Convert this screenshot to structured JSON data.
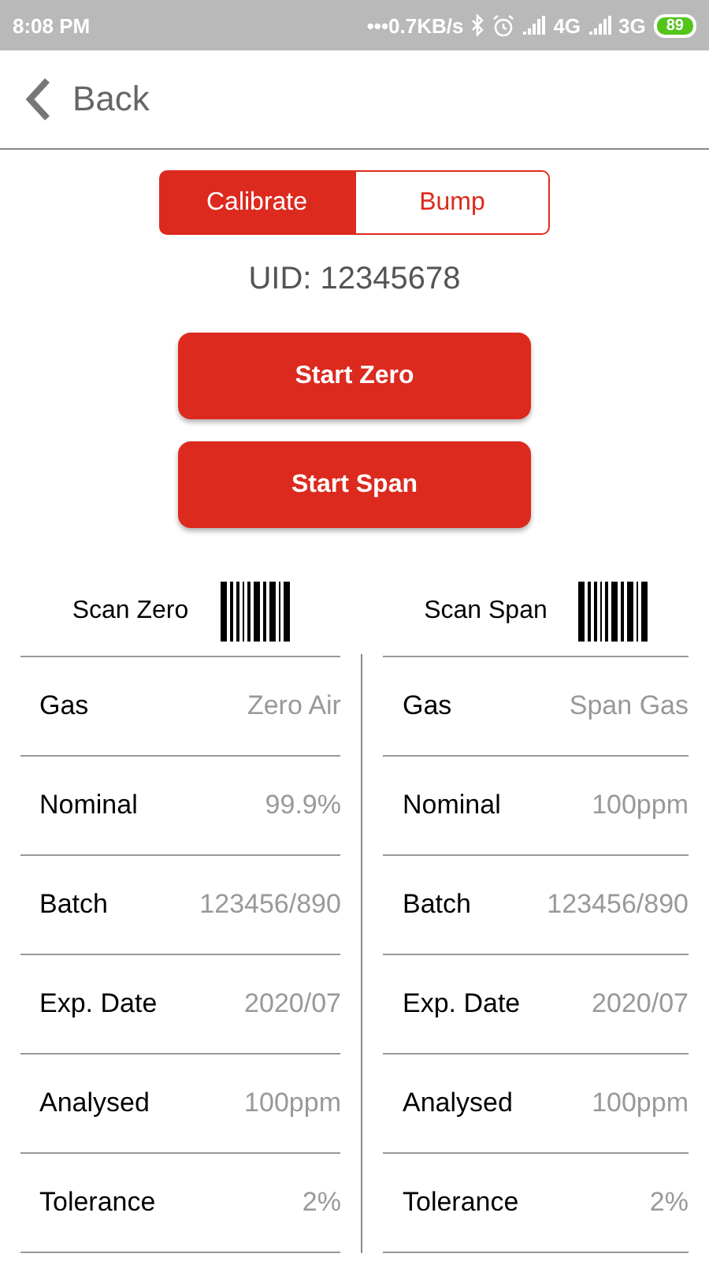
{
  "status_bar": {
    "time": "8:08 PM",
    "speed": "•••0.7KB/s",
    "network_1": "4G",
    "network_2": "3G",
    "battery": "89"
  },
  "header": {
    "back": "Back"
  },
  "tabs": [
    {
      "label": "Calibrate",
      "selected": true
    },
    {
      "label": "Bump",
      "selected": false
    }
  ],
  "uid": "UID: 12345678",
  "buttons": [
    "Start Zero",
    "Start Span"
  ],
  "panels": [
    {
      "scan": "Scan Zero",
      "rows": [
        {
          "label": "Gas",
          "value": "Zero Air"
        },
        {
          "label": "Nominal",
          "value": "99.9%"
        },
        {
          "label": "Batch",
          "value": "123456/890"
        },
        {
          "label": "Exp. Date",
          "value": "2020/07"
        },
        {
          "label": "Analysed",
          "value": "100ppm"
        },
        {
          "label": "Tolerance",
          "value": "2%"
        }
      ]
    },
    {
      "scan": "Scan Span",
      "rows": [
        {
          "label": "Gas",
          "value": "Span Gas"
        },
        {
          "label": "Nominal",
          "value": "100ppm"
        },
        {
          "label": "Batch",
          "value": "123456/890"
        },
        {
          "label": "Exp. Date",
          "value": "2020/07"
        },
        {
          "label": "Analysed",
          "value": "100ppm"
        },
        {
          "label": "Tolerance",
          "value": "2%"
        }
      ]
    }
  ]
}
